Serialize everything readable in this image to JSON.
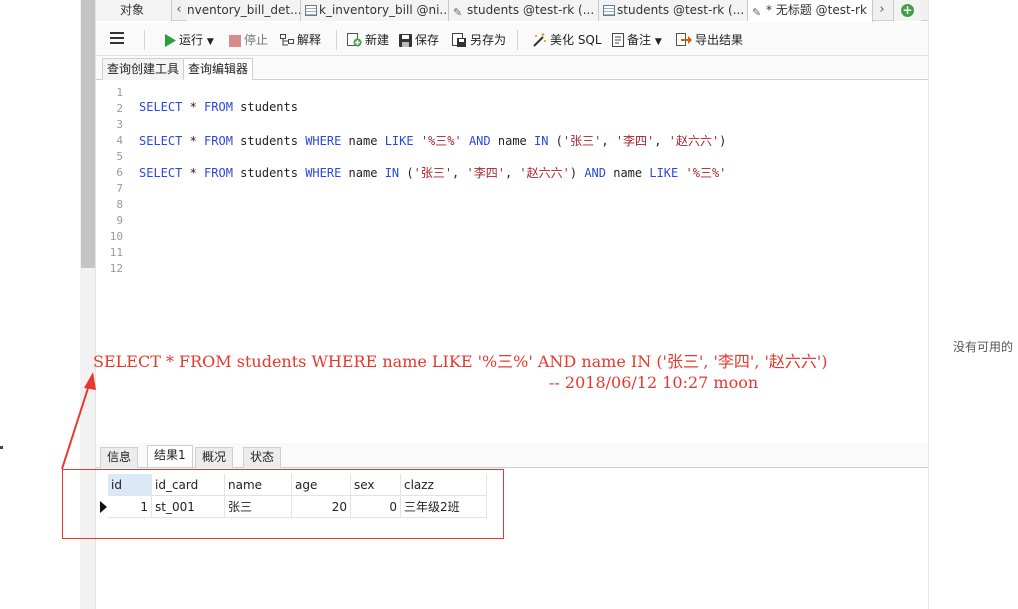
{
  "tabs": [
    {
      "label": "对象",
      "icon": "none"
    },
    {
      "label": "nventory_bill_det...",
      "icon": "table-icon"
    },
    {
      "label": "k_inventory_bill @ni...",
      "icon": "table-icon"
    },
    {
      "label": "students @test-rk (...",
      "icon": "query-icon"
    },
    {
      "label": "students @test-rk (...",
      "icon": "table-icon"
    },
    {
      "label": "* 无标题 @test-rk",
      "icon": "query-icon"
    }
  ],
  "toolbar": {
    "run": "运行",
    "stop": "停止",
    "explain": "解释",
    "new": "新建",
    "save": "保存",
    "save_as": "另存为",
    "beautify": "美化 SQL",
    "comment": "备注",
    "export": "导出结果"
  },
  "subtabs": {
    "builder": "查询创建工具",
    "editor": "查询编辑器"
  },
  "editor": {
    "line_numbers": [
      "1",
      "2",
      "3",
      "4",
      "5",
      "6",
      "7",
      "8",
      "9",
      "10",
      "11",
      "12"
    ],
    "line2": {
      "k1": "SELECT",
      "star": " * ",
      "k2": "FROM",
      "rest": " students"
    },
    "line4": {
      "k1": "SELECT",
      "star": " * ",
      "k2": "FROM",
      "t1": " students ",
      "k3": "WHERE",
      "t2": " name ",
      "k4": "LIKE",
      "s1": " '%三%' ",
      "k5": "AND",
      "t3": " name ",
      "k6": "IN",
      "t4": " (",
      "s2": "'张三'",
      "c1": ", ",
      "s3": "'李四'",
      "c2": ", ",
      "s4": "'赵六六'",
      "end": ")"
    },
    "line6": {
      "k1": "SELECT",
      "star": " * ",
      "k2": "FROM",
      "t1": " students ",
      "k3": "WHERE",
      "t2": " name ",
      "k4": "IN",
      "t3": " (",
      "s1": "'张三'",
      "c1": ", ",
      "s2": "'李四'",
      "c2": ", ",
      "s3": "'赵六六'",
      "t4": ") ",
      "k5": "AND",
      "t5": " name ",
      "k6": "LIKE",
      "s4": " '%三%'"
    }
  },
  "annotation": {
    "query": "SELECT * FROM students WHERE name LIKE '%三%' AND name IN ('张三', '李四', '赵六六')",
    "signature": "-- 2018/06/12  10:27  moon"
  },
  "side_text": "没有可用的",
  "result_tabs": {
    "info": "信息",
    "result1": "结果1",
    "overview": "概况",
    "status": "状态"
  },
  "grid": {
    "columns": [
      "id",
      "id_card",
      "name",
      "age",
      "sex",
      "clazz"
    ],
    "rows": [
      {
        "id": "1",
        "id_card": "st_001",
        "name": "张三",
        "age": "20",
        "sex": "0",
        "clazz": "三年级2班"
      }
    ]
  },
  "colors": {
    "annotation": "#e8372c",
    "keyword": "#2b48e0",
    "string": "#a7232c"
  }
}
